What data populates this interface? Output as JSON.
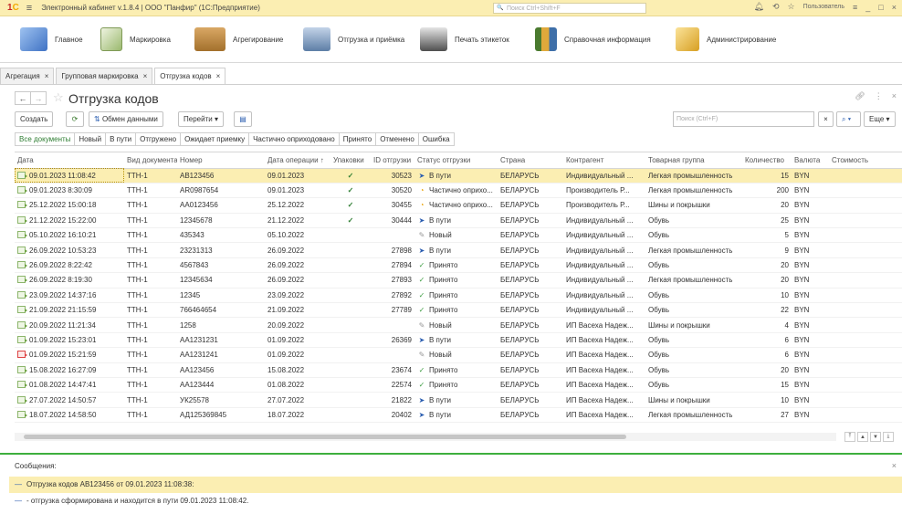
{
  "titlebar": {
    "app_title": "Электронный кабинет v.1.8.4 | ООО \"Панфир\"  (1С:Предприятие)",
    "search_placeholder": "Поиск Ctrl+Shift+F",
    "user": "Пользователь"
  },
  "sections": [
    {
      "label": "Главное",
      "icon": "home-folder-icon",
      "color": "#5b8fd6"
    },
    {
      "label": "Маркировка",
      "icon": "marking-checklist-icon",
      "color": "#9bb96f"
    },
    {
      "label": "Агрегирование",
      "icon": "box-icon",
      "color": "#c08a3e"
    },
    {
      "label": "Отгрузка и приёмка",
      "icon": "truck-icon",
      "color": "#6f8fb6"
    },
    {
      "label": "Печать этикеток",
      "icon": "printer-icon",
      "color": "#6b6b6b"
    },
    {
      "label": "Справочная информация",
      "icon": "books-icon",
      "color": "#d9a23b"
    },
    {
      "label": "Администрирование",
      "icon": "admin-icon",
      "color": "#e2b341"
    }
  ],
  "open_tabs": [
    "Агрегация",
    "Групповая маркировка",
    "Отгрузка кодов"
  ],
  "form": {
    "title": "Отгрузка кодов",
    "buttons": {
      "create": "Создать",
      "exchange": "Обмен данными",
      "goto": "Перейти",
      "more": "Еще"
    },
    "search_placeholder": "Поиск (Ctrl+F)"
  },
  "filters": [
    "Все документы",
    "Новый",
    "В пути",
    "Отгружено",
    "Ожидает приемку",
    "Частично оприходовано",
    "Принято",
    "Отменено",
    "Ошибка"
  ],
  "table": {
    "columns": [
      "Дата",
      "Вид документа",
      "Номер",
      "Дата операции ↑",
      "Упаковки",
      "ID отгрузки",
      "Статус отгрузки",
      "Страна",
      "Контрагент",
      "Товарная группа",
      "Количество",
      "Валюта",
      "Стоимость"
    ],
    "rows": [
      {
        "date": "09.01.2023 11:08:42",
        "type": "ТТН-1",
        "number": "AB123456",
        "op_date": "09.01.2023",
        "pack": "✓",
        "id": "30523",
        "status": "В пути",
        "status_kind": "transit",
        "country": "БЕЛАРУСЬ",
        "partner": "Индивидуальный ...",
        "group": "Легкая промышленность",
        "qty": "15",
        "currency": "BYN",
        "doc_icon": "normal"
      },
      {
        "date": "09.01.2023 8:30:09",
        "type": "ТТН-1",
        "number": "AR0987654",
        "op_date": "09.01.2023",
        "pack": "✓",
        "id": "30520",
        "status": "Частично оприхо...",
        "status_kind": "partial",
        "country": "БЕЛАРУСЬ",
        "partner": "Производитель Р...",
        "group": "Легкая промышленность",
        "qty": "200",
        "currency": "BYN",
        "doc_icon": "normal"
      },
      {
        "date": "25.12.2022 15:00:18",
        "type": "ТТН-1",
        "number": "AA0123456",
        "op_date": "25.12.2022",
        "pack": "✓",
        "id": "30455",
        "status": "Частично оприхо...",
        "status_kind": "partial",
        "country": "БЕЛАРУСЬ",
        "partner": "Производитель Р...",
        "group": "Шины и покрышки",
        "qty": "20",
        "currency": "BYN",
        "doc_icon": "normal"
      },
      {
        "date": "21.12.2022 15:22:00",
        "type": "ТТН-1",
        "number": "12345678",
        "op_date": "21.12.2022",
        "pack": "✓",
        "id": "30444",
        "status": "В пути",
        "status_kind": "transit",
        "country": "БЕЛАРУСЬ",
        "partner": "Индивидуальный ...",
        "group": "Обувь",
        "qty": "25",
        "currency": "BYN",
        "doc_icon": "normal"
      },
      {
        "date": "05.10.2022 16:10:21",
        "type": "ТТН-1",
        "number": "435343",
        "op_date": "05.10.2022",
        "pack": "",
        "id": "",
        "status": "Новый",
        "status_kind": "new",
        "country": "БЕЛАРУСЬ",
        "partner": "Индивидуальный ...",
        "group": "Обувь",
        "qty": "5",
        "currency": "BYN",
        "doc_icon": "normal"
      },
      {
        "date": "26.09.2022 10:53:23",
        "type": "ТТН-1",
        "number": "23231313",
        "op_date": "26.09.2022",
        "pack": "",
        "id": "27898",
        "status": "В пути",
        "status_kind": "transit",
        "country": "БЕЛАРУСЬ",
        "partner": "Индивидуальный ...",
        "group": "Легкая промышленность",
        "qty": "9",
        "currency": "BYN",
        "doc_icon": "normal"
      },
      {
        "date": "26.09.2022 8:22:42",
        "type": "ТТН-1",
        "number": "4567843",
        "op_date": "26.09.2022",
        "pack": "",
        "id": "27894",
        "status": "Принято",
        "status_kind": "accepted",
        "country": "БЕЛАРУСЬ",
        "partner": "Индивидуальный ...",
        "group": "Обувь",
        "qty": "20",
        "currency": "BYN",
        "doc_icon": "normal"
      },
      {
        "date": "26.09.2022 8:19:30",
        "type": "ТТН-1",
        "number": "12345634",
        "op_date": "26.09.2022",
        "pack": "",
        "id": "27893",
        "status": "Принято",
        "status_kind": "accepted",
        "country": "БЕЛАРУСЬ",
        "partner": "Индивидуальный ...",
        "group": "Легкая промышленность",
        "qty": "20",
        "currency": "BYN",
        "doc_icon": "normal"
      },
      {
        "date": "23.09.2022 14:37:16",
        "type": "ТТН-1",
        "number": "12345",
        "op_date": "23.09.2022",
        "pack": "",
        "id": "27892",
        "status": "Принято",
        "status_kind": "accepted",
        "country": "БЕЛАРУСЬ",
        "partner": "Индивидуальный ...",
        "group": "Обувь",
        "qty": "10",
        "currency": "BYN",
        "doc_icon": "normal"
      },
      {
        "date": "21.09.2022 21:15:59",
        "type": "ТТН-1",
        "number": "766464654",
        "op_date": "21.09.2022",
        "pack": "",
        "id": "27789",
        "status": "Принято",
        "status_kind": "accepted",
        "country": "БЕЛАРУСЬ",
        "partner": "Индивидуальный ...",
        "group": "Обувь",
        "qty": "22",
        "currency": "BYN",
        "doc_icon": "normal"
      },
      {
        "date": "20.09.2022 11:21:34",
        "type": "ТТН-1",
        "number": "1258",
        "op_date": "20.09.2022",
        "pack": "",
        "id": "",
        "status": "Новый",
        "status_kind": "new",
        "country": "БЕЛАРУСЬ",
        "partner": "ИП Васеха Надеж...",
        "group": "Шины и покрышки",
        "qty": "4",
        "currency": "BYN",
        "doc_icon": "normal"
      },
      {
        "date": "01.09.2022 15:23:01",
        "type": "ТТН-1",
        "number": "AA1231231",
        "op_date": "01.09.2022",
        "pack": "",
        "id": "26369",
        "status": "В пути",
        "status_kind": "transit",
        "country": "БЕЛАРУСЬ",
        "partner": "ИП Васеха Надеж...",
        "group": "Обувь",
        "qty": "6",
        "currency": "BYN",
        "doc_icon": "normal"
      },
      {
        "date": "01.09.2022 15:21:59",
        "type": "ТТН-1",
        "number": "AA1231241",
        "op_date": "01.09.2022",
        "pack": "",
        "id": "",
        "status": "Новый",
        "status_kind": "new",
        "country": "БЕЛАРУСЬ",
        "partner": "ИП Васеха Надеж...",
        "group": "Обувь",
        "qty": "6",
        "currency": "BYN",
        "doc_icon": "red"
      },
      {
        "date": "15.08.2022 16:27:09",
        "type": "ТТН-1",
        "number": "AA123456",
        "op_date": "15.08.2022",
        "pack": "",
        "id": "23674",
        "status": "Принято",
        "status_kind": "accepted",
        "country": "БЕЛАРУСЬ",
        "partner": "ИП Васеха Надеж...",
        "group": "Обувь",
        "qty": "20",
        "currency": "BYN",
        "doc_icon": "normal"
      },
      {
        "date": "01.08.2022 14:47:41",
        "type": "ТТН-1",
        "number": "AA123444",
        "op_date": "01.08.2022",
        "pack": "",
        "id": "22574",
        "status": "Принято",
        "status_kind": "accepted",
        "country": "БЕЛАРУСЬ",
        "partner": "ИП Васеха Надеж...",
        "group": "Обувь",
        "qty": "15",
        "currency": "BYN",
        "doc_icon": "normal"
      },
      {
        "date": "27.07.2022 14:50:57",
        "type": "ТТН-1",
        "number": "УК25578",
        "op_date": "27.07.2022",
        "pack": "",
        "id": "21822",
        "status": "В пути",
        "status_kind": "transit",
        "country": "БЕЛАРУСЬ",
        "partner": "ИП Васеха Надеж...",
        "group": "Шины и покрышки",
        "qty": "10",
        "currency": "BYN",
        "doc_icon": "normal"
      },
      {
        "date": "18.07.2022 14:58:50",
        "type": "ТТН-1",
        "number": "АД125369845",
        "op_date": "18.07.2022",
        "pack": "",
        "id": "20402",
        "status": "В пути",
        "status_kind": "transit",
        "country": "БЕЛАРУСЬ",
        "partner": "ИП Васеха Надеж...",
        "group": "Легкая промышленность",
        "qty": "27",
        "currency": "BYN",
        "doc_icon": "normal"
      }
    ]
  },
  "messages": {
    "title": "Сообщения:",
    "items": [
      "Отгрузка кодов AB123456 от 09.01.2023 11:08:38:",
      "- отгрузка сформирована и находится в пути 09.01.2023 11:08:42."
    ]
  },
  "colors": {
    "selection": "#fbeeb2",
    "accent_green": "#3daf3d"
  }
}
